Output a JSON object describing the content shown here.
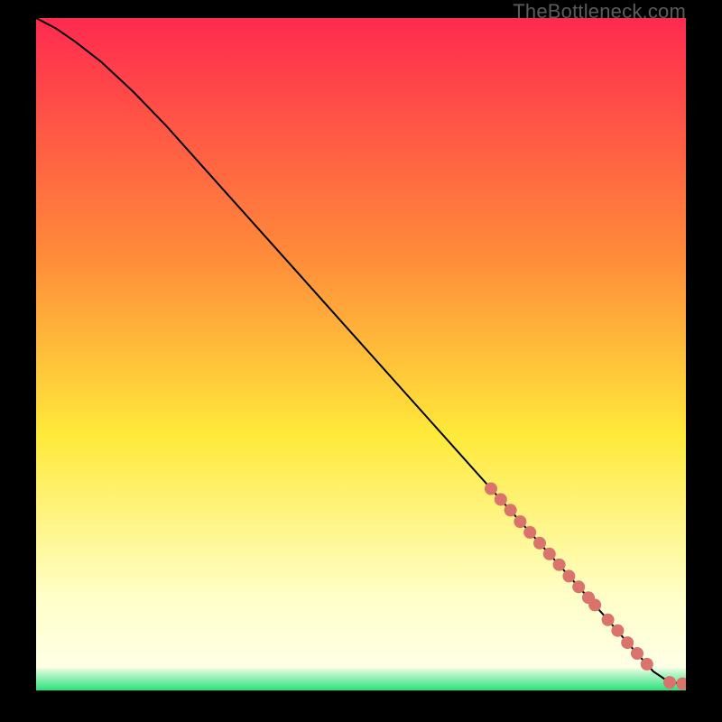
{
  "watermark": "TheBottleneck.com",
  "colors": {
    "gradient_top": "#ff2a4f",
    "gradient_mid1": "#ff8a3a",
    "gradient_mid2": "#ffe93a",
    "gradient_low": "#ffffc8",
    "gradient_green": "#28e27b",
    "curve": "#000000",
    "marker": "#d9736b",
    "frame": "#000000"
  },
  "chart_data": {
    "type": "line",
    "title": "",
    "xlabel": "",
    "ylabel": "",
    "xlim": [
      0,
      100
    ],
    "ylim": [
      0,
      100
    ],
    "curve": {
      "x": [
        0,
        3,
        6,
        10,
        15,
        20,
        30,
        40,
        50,
        60,
        70,
        80,
        88,
        92,
        95,
        97.5,
        100
      ],
      "y": [
        100,
        98.5,
        96.5,
        93.5,
        89,
        84,
        73.2,
        62.4,
        51.6,
        40.8,
        30,
        19.2,
        10.5,
        6.0,
        2.8,
        1.2,
        1.0
      ]
    },
    "markers": {
      "x": [
        70,
        71.5,
        73,
        74.5,
        76,
        77.5,
        79,
        80.5,
        82,
        83.5,
        85,
        86,
        88,
        89.5,
        91,
        92.5,
        94,
        97.5,
        99.5
      ],
      "y": [
        30.0,
        28.4,
        26.8,
        25.1,
        23.5,
        21.9,
        20.3,
        18.7,
        17.0,
        15.4,
        13.8,
        12.7,
        10.5,
        8.9,
        7.1,
        5.5,
        3.9,
        1.2,
        1.0
      ]
    }
  }
}
